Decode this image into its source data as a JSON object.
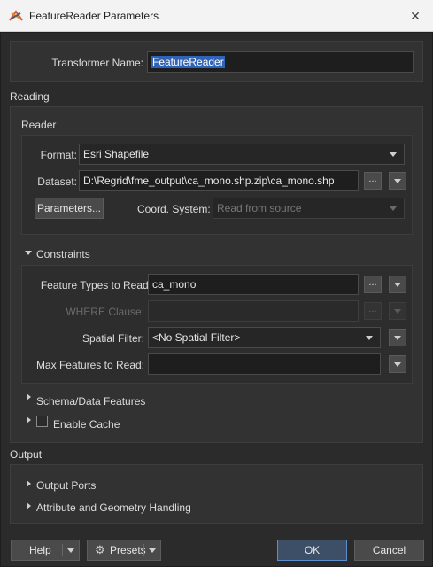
{
  "window": {
    "title": "FeatureReader Parameters"
  },
  "transformer": {
    "label": "Transformer Name:",
    "value": "FeatureReader"
  },
  "reading": {
    "section": "Reading",
    "reader": {
      "group": "Reader",
      "format_label": "Format:",
      "format_value": "Esri Shapefile",
      "dataset_label": "Dataset:",
      "dataset_value": "D:\\Regrid\\fme_output\\ca_mono.shp.zip\\ca_mono.shp",
      "browse": "...",
      "parameters_button": "Parameters...",
      "coord_label": "Coord. System:",
      "coord_value": "Read from source"
    },
    "constraints": {
      "title": "Constraints",
      "feature_types_label": "Feature Types to Read:",
      "feature_types_value": "ca_mono",
      "where_label": "WHERE Clause:",
      "where_value": "",
      "spatial_label": "Spatial Filter:",
      "spatial_value": "<No Spatial Filter>",
      "max_label": "Max Features to Read:",
      "max_value": ""
    },
    "schema": "Schema/Data Features",
    "cache": {
      "label": "Enable Cache",
      "checked": false
    }
  },
  "output": {
    "section": "Output",
    "ports": "Output Ports",
    "attr": "Attribute and Geometry Handling"
  },
  "footer": {
    "help": "Help",
    "presets": "Presets",
    "ok": "OK",
    "cancel": "Cancel"
  }
}
